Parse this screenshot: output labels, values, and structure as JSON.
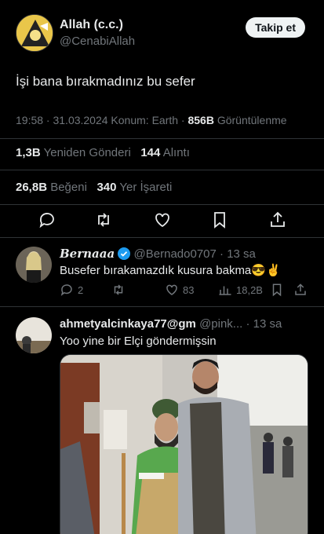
{
  "author": {
    "display_name": "Allah (c.c.)",
    "handle": "@CenabiAllah",
    "follow_label": "Takip et"
  },
  "tweet": {
    "text": "İşi bana bırakmadınız bu sefer",
    "time": "19:58 · 31.03.2024 Konum: Earth ·",
    "views_count": "856B",
    "views_label": "Görüntülenme"
  },
  "stats": {
    "reposts_count": "1,3B",
    "reposts_label": "Yeniden Gönderi",
    "quotes_count": "144",
    "quotes_label": "Alıntı",
    "likes_count": "26,8B",
    "likes_label": "Beğeni",
    "bookmarks_count": "340",
    "bookmarks_label": "Yer İşareti"
  },
  "replies": [
    {
      "display_name": "Bernaaa",
      "handle": "@Bernado0707",
      "time": "· 13 sa",
      "text": "Busefer bırakamazdık kusura bakma😎✌️",
      "reply_count": "2",
      "repost_count": "",
      "like_count": "83",
      "view_count": "18,2B"
    },
    {
      "display_name": "ahmetyalcinkaya77@gm",
      "handle": "@pink...",
      "time": "· 13 sa",
      "text": "Yoo yine bir Elçi göndermişsin"
    }
  ],
  "colors": {
    "background": "#000000",
    "text": "#e7e9ea",
    "muted": "#71767b",
    "divider": "#2f3336",
    "verified": "#1d9bf0"
  }
}
